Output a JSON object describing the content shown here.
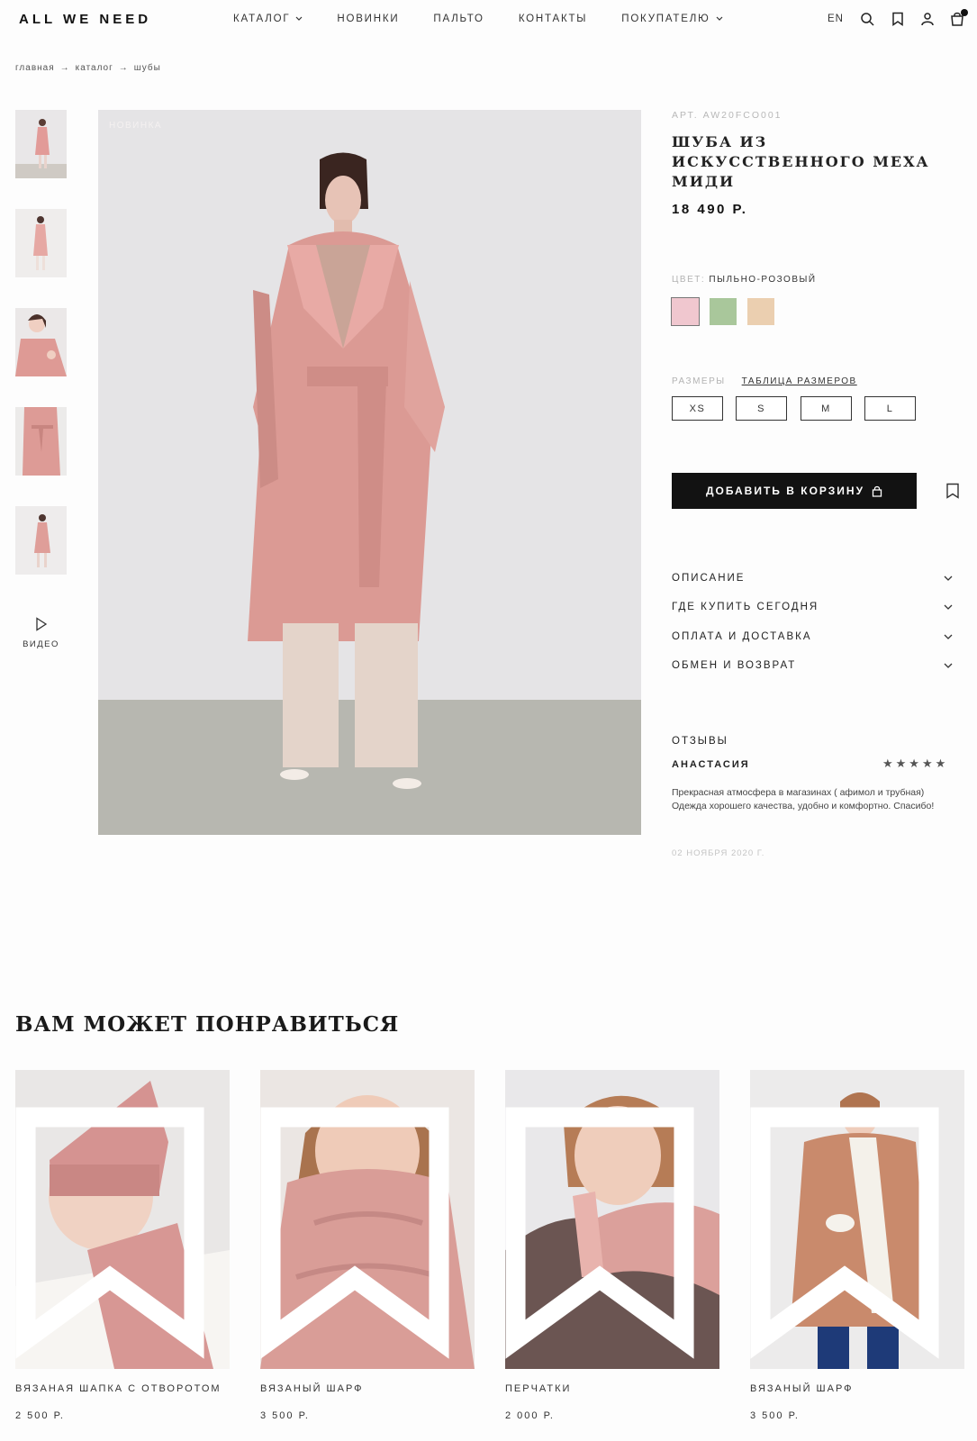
{
  "header": {
    "logo": "ALL WE NEED",
    "nav": [
      {
        "label": "КАТАЛОГ",
        "dropdown": true
      },
      {
        "label": "НОВИНКИ",
        "dropdown": false
      },
      {
        "label": "ПАЛЬТО",
        "dropdown": false
      },
      {
        "label": "КОНТАКТЫ",
        "dropdown": false
      },
      {
        "label": "ПОКУПАТЕЛЮ",
        "dropdown": true
      }
    ],
    "lang": "EN",
    "icons": [
      "search-icon",
      "bookmark-icon",
      "user-icon",
      "bag-icon"
    ]
  },
  "breadcrumb": [
    "главная",
    "каталог",
    "шубы"
  ],
  "gallery": {
    "badge": "НОВИНКА",
    "thumbnails": 5,
    "video_label": "ВИДЕО"
  },
  "product": {
    "article": "АРТ. AW20FCO001",
    "title": "ШУБА ИЗ ИСКУССТВЕННОГО МЕХА МИДИ",
    "price": "18 490 Р.",
    "color_label": "ЦВЕТ:",
    "color_value": "ПЫЛЬНО-РОЗОВЫЙ",
    "colors": [
      "#f0c7cf",
      "#a9c79b",
      "#ebcfb0"
    ],
    "sizes_label": "РАЗМЕРЫ",
    "size_table": "ТАБЛИЦА РАЗМЕРОВ",
    "sizes": [
      "XS",
      "S",
      "M",
      "L"
    ],
    "add_to_cart": "ДОБАВИТЬ В КОРЗИНУ",
    "accordion": [
      "ОПИСАНИЕ",
      "ГДЕ КУПИТЬ СЕГОДНЯ",
      "ОПЛАТА И ДОСТАВКА",
      "ОБМЕН И ВОЗВРАТ"
    ]
  },
  "reviews": {
    "title": "ОТЗЫВЫ",
    "author": "АНАСТАСИЯ",
    "stars": "★★★★★",
    "text": "Прекрасная атмосфера в магазинах ( афимол и трубная) Одежда хорошего качества, удобно и комфортно. Спасибо!",
    "date": "02 НОЯБРЯ 2020 Г."
  },
  "recommendations": {
    "title": "ВАМ МОЖЕТ ПОНРАВИТЬСЯ",
    "items": [
      {
        "name": "ВЯЗАНАЯ ШАПКА С ОТВОРОТОМ",
        "price": "2 500 Р."
      },
      {
        "name": "ВЯЗАНЫЙ ШАРФ",
        "price": "3 500 Р."
      },
      {
        "name": "ПЕРЧАТКИ",
        "price": "2 000 Р."
      },
      {
        "name": "ВЯЗАНЫЙ ШАРФ",
        "price": "3 500 Р."
      }
    ]
  }
}
